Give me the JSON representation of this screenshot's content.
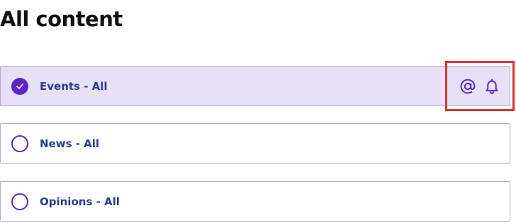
{
  "heading": "All content",
  "options": [
    {
      "label": "Events - All",
      "selected": true
    },
    {
      "label": "News - All",
      "selected": false
    },
    {
      "label": "Opinions - All",
      "selected": false
    }
  ],
  "selected_actions": {
    "icons": [
      "at-sign-icon",
      "bell-icon"
    ]
  },
  "colors": {
    "accent": "#5b26c4",
    "label_text": "#2c3e8c",
    "selected_bg": "#e8e0f6",
    "highlight": "#e0322a"
  }
}
